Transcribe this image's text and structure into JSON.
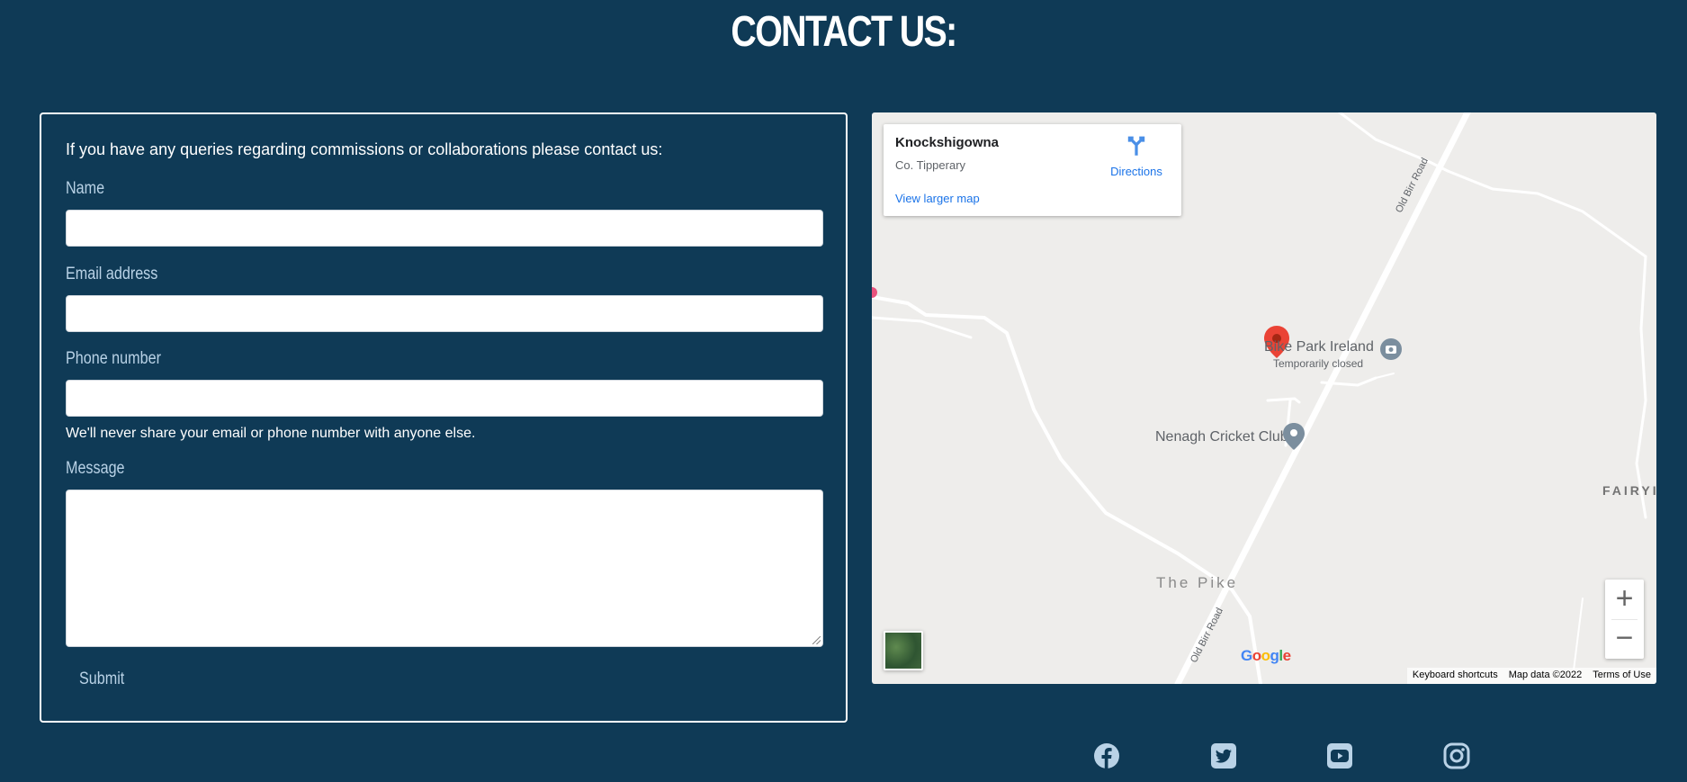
{
  "header": {
    "title": "CONTACT US:"
  },
  "form": {
    "intro": "If you have any queries regarding commissions or collaborations please contact us:",
    "name_label": "Name",
    "email_label": "Email address",
    "phone_label": "Phone number",
    "privacy_note": "We'll never share your email or phone number with anyone else.",
    "message_label": "Message",
    "submit_label": "Submit",
    "name_value": "",
    "email_value": "",
    "phone_value": "",
    "message_value": ""
  },
  "map": {
    "place_name": "Knockshigowna",
    "place_region": "Co. Tipperary",
    "directions_label": "Directions",
    "larger_map_label": "View larger map",
    "labels": {
      "bike_park": "Bike Park Ireland",
      "bike_park_status": "Temporarily closed",
      "cricket_club": "Nenagh Cricket Club",
      "the_pike": "The Pike",
      "fairy": "FAIRYI",
      "road_top": "Old Birr Road",
      "road_bottom": "Old Birr Road"
    },
    "zoom_in_label": "+",
    "zoom_out_label": "−",
    "google_logo": "Google",
    "attribution": {
      "shortcuts": "Keyboard shortcuts",
      "map_data": "Map data ©2022",
      "terms": "Terms of Use"
    },
    "colors": {
      "pin": "#ea4335",
      "link": "#1a73e8",
      "poi": "#7b8e9e"
    }
  },
  "social": [
    {
      "icon": "facebook-icon"
    },
    {
      "icon": "twitter-icon"
    },
    {
      "icon": "youtube-icon"
    },
    {
      "icon": "instagram-icon"
    }
  ],
  "colors": {
    "background": "#0f3a56",
    "label": "#b9d2e6",
    "icon": "#b9d2e6"
  }
}
